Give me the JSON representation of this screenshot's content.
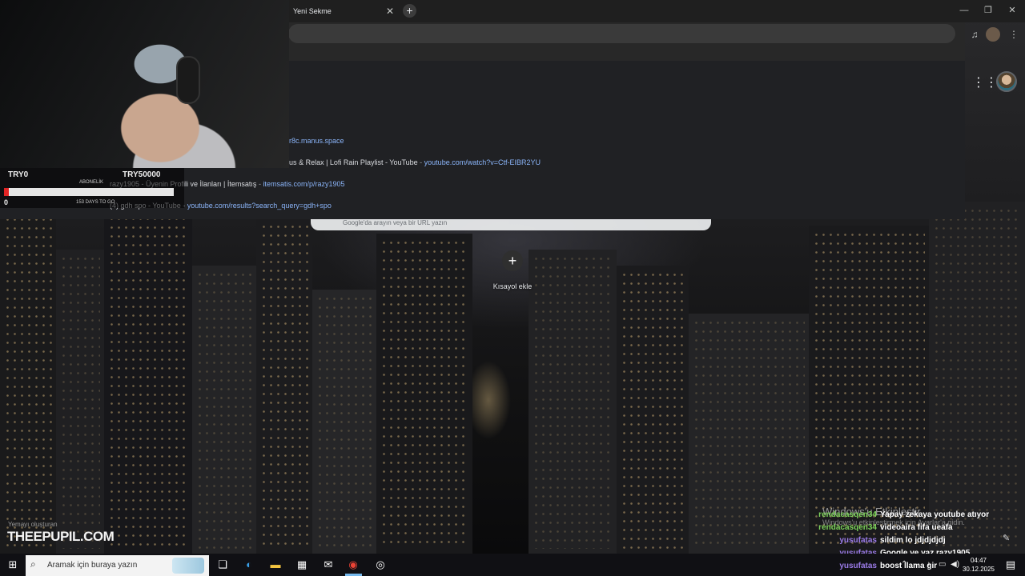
{
  "browser": {
    "tab_title": "Yeni Sekme",
    "tab_close_icon": "close-icon",
    "new_tab_icon": "plus-icon",
    "window_controls": [
      "minimize-icon",
      "restore-icon",
      "close-icon"
    ],
    "suggestions": [
      {
        "title": "",
        "url": "r8c.manus.space"
      },
      {
        "title": "alcony ☁ Chill Lofi Music for Deep Focus & Relax | Lofi Rain Playlist - YouTube",
        "url": "youtube.com/watch?v=Ctf-EIBR2YU"
      },
      {
        "title": "razy1905 - Üyenin Profili ve İlanları | İtemsatış",
        "url": "itemsatis.com/p/razy1905"
      },
      {
        "title": "(4) gdh spo - YouTube",
        "url": "youtube.com/results?search_query=gdh+spo"
      }
    ],
    "ntp_search_placeholder": "Google'da arayın veya bir URL yazın",
    "shortcut_add_label": "Kısayol ekle"
  },
  "stream_overlay": {
    "left_code": "TRY0",
    "right_code": "TRY50000",
    "sub_label": "ABONELİK",
    "zero_label": "0",
    "days_label": "153 DAYS TO GO",
    "progress_fraction": 0.03,
    "watermark_small": "Yemayı oluşturan",
    "watermark": "THEEPUPIL.COM"
  },
  "windows_activation": {
    "title": "Windows'u Etkinleştir",
    "subtitle": "Windows'u etkinleştirmek için Ayarlar'a gidin."
  },
  "chat": [
    {
      "user": "rendacasqen34",
      "message": "Yapay zekaya youtube atıyor",
      "color": "#7dd35a"
    },
    {
      "user": "rendacasqen34",
      "message": "videoaira fifa ueafa",
      "color": "#7dd35a"
    },
    {
      "user": "yusufatas",
      "message": "sildim lo jdjdjdjdj",
      "color": "#9b7be8"
    },
    {
      "user": "yusufatas",
      "message": "Google ye yaz razy1905",
      "color": "#9b7be8"
    },
    {
      "user": "yusufatas",
      "message": "boost llama gir",
      "color": "#9b7be8"
    }
  ],
  "taskbar": {
    "search_placeholder": "Aramak için buraya yazın",
    "time": "04:47",
    "date": "30.12.2025"
  }
}
